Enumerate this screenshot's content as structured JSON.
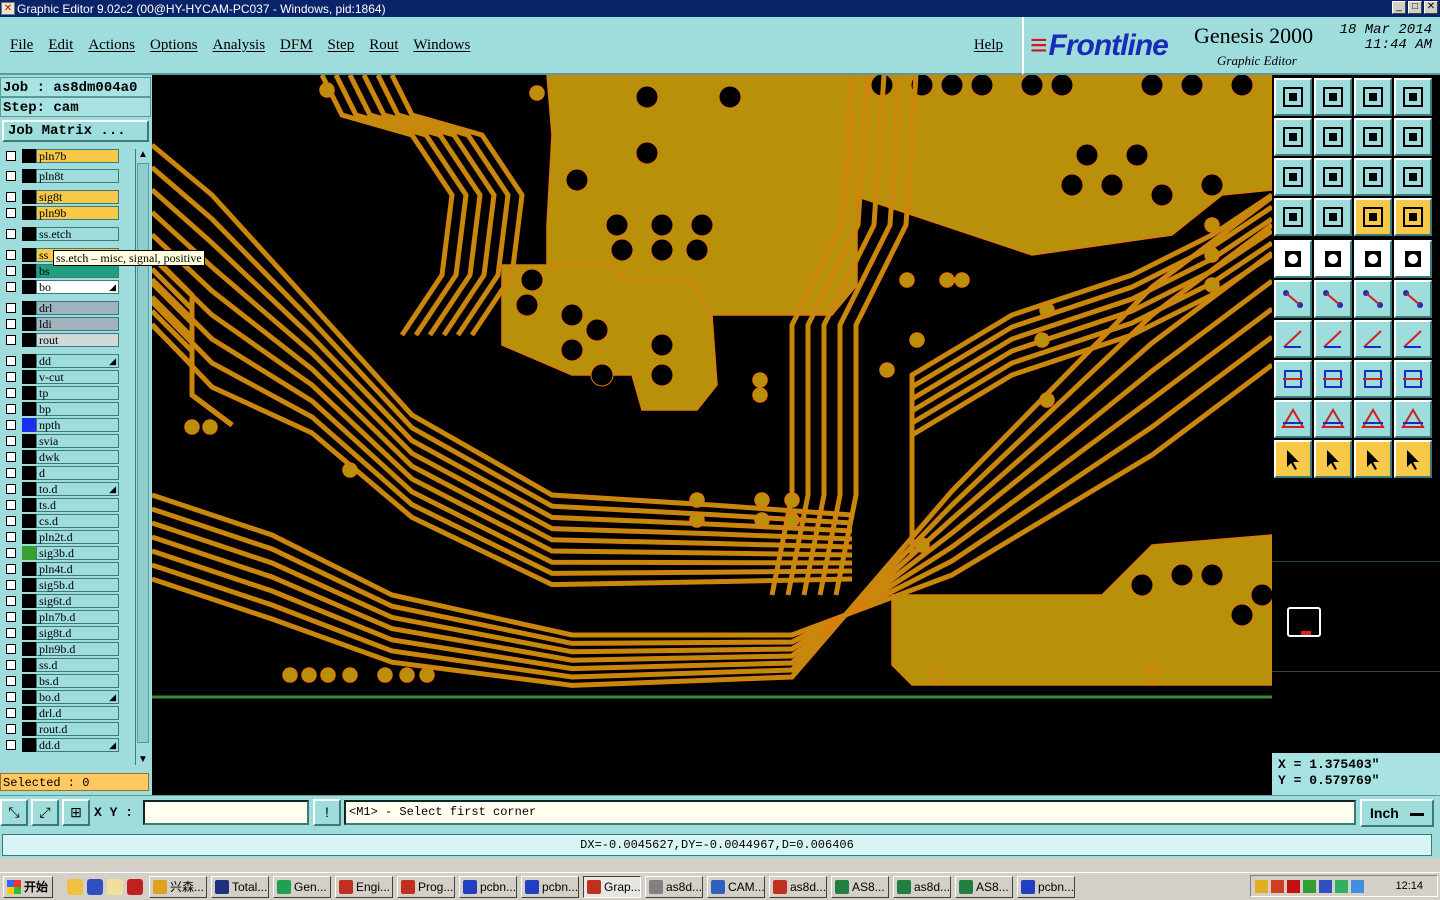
{
  "window": {
    "title": "Graphic Editor 9.02c2 (00@HY-HYCAM-PC037 - Windows, pid:1864)"
  },
  "menu": {
    "items": [
      "File",
      "Edit",
      "Actions",
      "Options",
      "Analysis",
      "DFM",
      "Step",
      "Rout",
      "Windows"
    ],
    "help": "Help"
  },
  "brand": {
    "logo": "Frontline",
    "product": "Genesis 2000",
    "subtitle": "Graphic Editor",
    "date": "18 Mar 2014",
    "time": "11:44 AM"
  },
  "job": {
    "job_line": "Job : as8dm004a0",
    "step_line": "Step: cam",
    "matrix_button": "Job Matrix ..."
  },
  "layers": [
    {
      "name": "pln7b",
      "bg": "#f8c848",
      "swatch": "#000"
    },
    {
      "name": "pln8t",
      "bg": "#9fdcdc",
      "swatch": "#000"
    },
    {
      "name": "sig8t",
      "bg": "#f8c848",
      "swatch": "#000"
    },
    {
      "name": "pln9b",
      "bg": "#f8c848",
      "swatch": "#000"
    },
    {
      "name": "ss.etch",
      "bg": "#9fdcdc",
      "swatch": "#000"
    },
    {
      "name": "ss",
      "bg": "#f8c848",
      "swatch": "#000"
    },
    {
      "name": "bs",
      "bg": "#20a080",
      "swatch": "#000"
    },
    {
      "name": "bo",
      "bg": "#ffffff",
      "swatch": "#000",
      "mark": "◢"
    },
    {
      "name": "drl",
      "bg": "#a0b4c0",
      "swatch": "#000"
    },
    {
      "name": "ldi",
      "bg": "#a0b4c0",
      "swatch": "#000"
    },
    {
      "name": "rout",
      "bg": "#d0d8d8",
      "swatch": "#000"
    },
    {
      "name": "dd",
      "bg": "#9fdcdc",
      "swatch": "#000",
      "mark": "◢"
    },
    {
      "name": "v-cut",
      "bg": "#9fdcdc",
      "swatch": "#000"
    },
    {
      "name": "tp",
      "bg": "#9fdcdc",
      "swatch": "#000"
    },
    {
      "name": "bp",
      "bg": "#9fdcdc",
      "swatch": "#000"
    },
    {
      "name": "npth",
      "bg": "#9fdcdc",
      "swatch": "#1b2ef0"
    },
    {
      "name": "svia",
      "bg": "#9fdcdc",
      "swatch": "#000"
    },
    {
      "name": "dwk",
      "bg": "#9fdcdc",
      "swatch": "#000"
    },
    {
      "name": "d",
      "bg": "#9fdcdc",
      "swatch": "#000"
    },
    {
      "name": "to.d",
      "bg": "#9fdcdc",
      "swatch": "#000",
      "mark": "◢"
    },
    {
      "name": "ts.d",
      "bg": "#9fdcdc",
      "swatch": "#000"
    },
    {
      "name": "cs.d",
      "bg": "#9fdcdc",
      "swatch": "#000"
    },
    {
      "name": "pln2t.d",
      "bg": "#9fdcdc",
      "swatch": "#000"
    },
    {
      "name": "sig3b.d",
      "bg": "#9fdcdc",
      "swatch": "#3aa030"
    },
    {
      "name": "pln4t.d",
      "bg": "#9fdcdc",
      "swatch": "#000"
    },
    {
      "name": "sig5b.d",
      "bg": "#9fdcdc",
      "swatch": "#000"
    },
    {
      "name": "sig6t.d",
      "bg": "#9fdcdc",
      "swatch": "#000"
    },
    {
      "name": "pln7b.d",
      "bg": "#9fdcdc",
      "swatch": "#000"
    },
    {
      "name": "sig8t.d",
      "bg": "#9fdcdc",
      "swatch": "#000"
    },
    {
      "name": "pln9b.d",
      "bg": "#9fdcdc",
      "swatch": "#000"
    },
    {
      "name": "ss.d",
      "bg": "#9fdcdc",
      "swatch": "#000"
    },
    {
      "name": "bs.d",
      "bg": "#9fdcdc",
      "swatch": "#000"
    },
    {
      "name": "bo.d",
      "bg": "#9fdcdc",
      "swatch": "#000",
      "mark": "◢"
    },
    {
      "name": "drl.d",
      "bg": "#9fdcdc",
      "swatch": "#000"
    },
    {
      "name": "rout.d",
      "bg": "#9fdcdc",
      "swatch": "#000"
    },
    {
      "name": "dd.d",
      "bg": "#9fdcdc",
      "swatch": "#000",
      "mark": "◢"
    }
  ],
  "tooltip": "ss.etch – misc, signal, positive",
  "selected": "Selected : 0",
  "coords": {
    "x": "X = 1.375403\"",
    "y": "Y = 0.579769\""
  },
  "bottom": {
    "xy_label": "X Y :",
    "xy_value": "",
    "prompt": "<M1> - Select first corner",
    "unit": "Inch"
  },
  "status": "DX=-0.0045627,DY=-0.0044967,D=0.006406",
  "colors": {
    "copper": "#b8900a",
    "trace_edge": "#e07a10",
    "board": "#000000",
    "panel": "#9fdcdc",
    "tool_active": "#f8c848"
  },
  "taskbar": {
    "start": "开始",
    "tasks": [
      {
        "label": "兴森...",
        "color": "#e0a020"
      },
      {
        "label": "Total...",
        "color": "#203080"
      },
      {
        "label": "Gen...",
        "color": "#20a050"
      },
      {
        "label": "Engi...",
        "color": "#c03020"
      },
      {
        "label": "Prog...",
        "color": "#c03020"
      },
      {
        "label": "pcbn...",
        "color": "#2040c0"
      },
      {
        "label": "pcbn...",
        "color": "#2040c0"
      },
      {
        "label": "Grap...",
        "color": "#c03020",
        "active": true
      },
      {
        "label": "as8d...",
        "color": "#808080"
      },
      {
        "label": "CAM...",
        "color": "#3060c0"
      },
      {
        "label": "as8d...",
        "color": "#c03020"
      },
      {
        "label": "AS8...",
        "color": "#208040"
      },
      {
        "label": "as8d...",
        "color": "#208040"
      },
      {
        "label": "AS8...",
        "color": "#208040"
      },
      {
        "label": "pcbn...",
        "color": "#2040c0"
      }
    ],
    "clock": "12:14"
  }
}
